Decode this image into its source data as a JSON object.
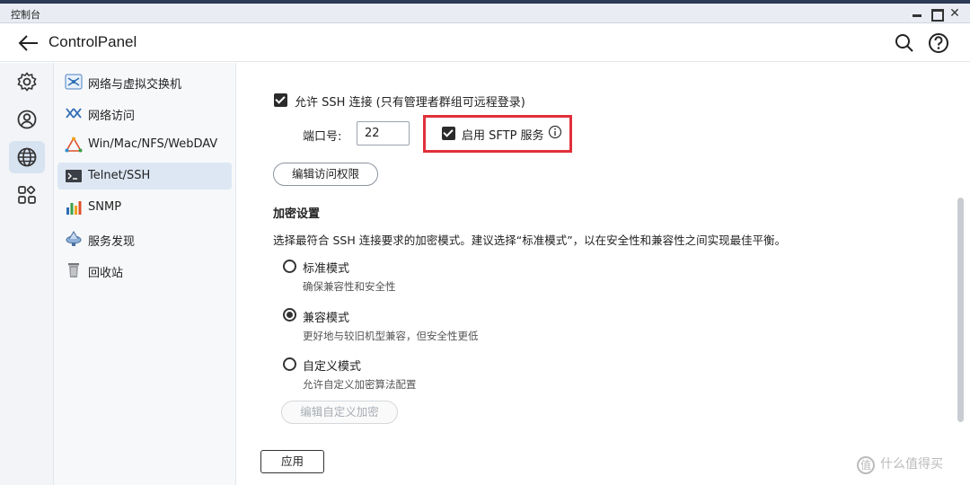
{
  "window": {
    "title": "控制台",
    "close_glyph": "✕"
  },
  "header": {
    "title": "ControlPanel",
    "back_icon": "arrow-left-icon",
    "search_icon": "search-icon",
    "help_icon": "help-icon"
  },
  "rail": {
    "items": [
      {
        "icon": "gear-icon",
        "active": false
      },
      {
        "icon": "user-circle-icon",
        "active": false
      },
      {
        "icon": "globe-icon",
        "active": true
      },
      {
        "icon": "apps-grid-icon",
        "active": false
      }
    ]
  },
  "sidebar": {
    "items": [
      {
        "label": "网络与虚拟交换机",
        "icon": "network-switch-icon"
      },
      {
        "label": "网络访问",
        "icon": "network-access-icon"
      },
      {
        "label": "Win/Mac/NFS/WebDAV",
        "icon": "triangle-protocol-icon"
      },
      {
        "label": "Telnet/SSH",
        "icon": "terminal-icon",
        "active": true
      },
      {
        "label": "SNMP",
        "icon": "bar-chart-icon"
      },
      {
        "label": "服务发现",
        "icon": "discovery-icon"
      },
      {
        "label": "回收站",
        "icon": "trash-icon"
      }
    ]
  },
  "main": {
    "allow_ssh_label": "允许 SSH 连接 (只有管理者群组可远程登录)",
    "allow_ssh_checked": true,
    "port_label": "端口号:",
    "port_value": "22",
    "sftp_label": "启用 SFTP 服务",
    "sftp_checked": true,
    "edit_access_button": "编辑访问权限",
    "encryption_title": "加密设置",
    "encryption_desc": "选择最符合 SSH 连接要求的加密模式。建议选择“标准模式”，以在安全性和兼容性之间实现最佳平衡。",
    "modes": [
      {
        "label": "标准模式",
        "desc": "确保兼容性和安全性",
        "selected": false
      },
      {
        "label": "兼容模式",
        "desc": "更好地与较旧机型兼容，但安全性更低",
        "selected": true
      },
      {
        "label": "自定义模式",
        "desc": "允许自定义加密算法配置",
        "selected": false
      }
    ],
    "edit_custom_button": "编辑自定义加密",
    "apply_button": "应用"
  },
  "watermark": {
    "text": "什么值得买",
    "logo_glyph": "值"
  },
  "colors": {
    "highlight_border": "#e0303a",
    "active_bg": "#dde7f4"
  }
}
